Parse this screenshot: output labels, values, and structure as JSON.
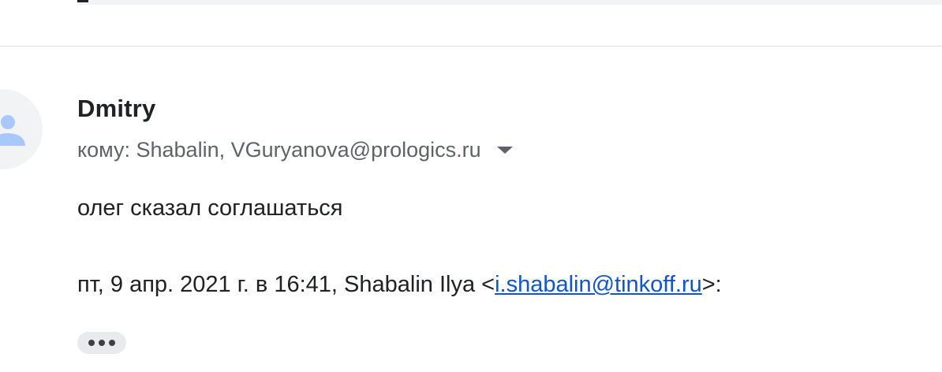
{
  "message": {
    "sender": "Dmitry",
    "recipients_label": "кому: Shabalin, VGuryanova@prologics.ru",
    "body": "олег сказал соглашаться",
    "quote": {
      "prefix": "пт, 9 апр. 2021 г. в 16:41, Shabalin Ilya <",
      "email": "i.shabalin@tinkoff.ru",
      "suffix": ">:"
    },
    "show_trimmed_icon": "ellipsis-icon"
  },
  "colors": {
    "sender": "#202124",
    "secondary_text": "#5f6368",
    "link": "#1155cc",
    "avatar_bg": "#f1f3f4",
    "avatar_icon": "#a8c7fa"
  },
  "icons": {
    "avatar": "person-icon",
    "recipients_toggle": "caret-down-icon"
  }
}
